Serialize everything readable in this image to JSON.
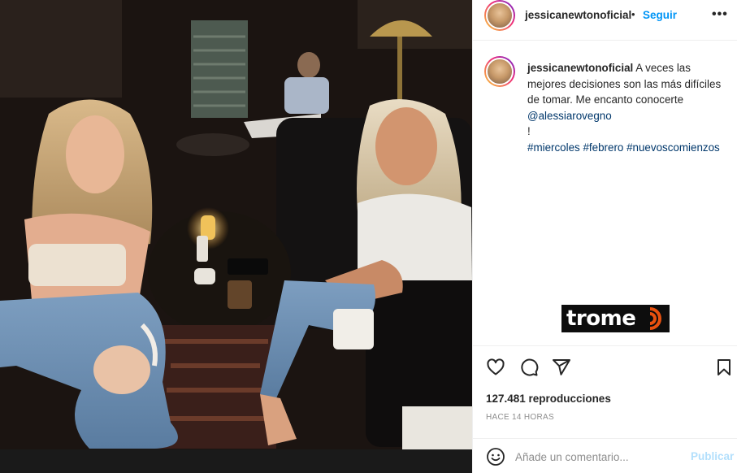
{
  "post": {
    "username": "jessicanewtonoficial",
    "separator": "•",
    "follow_label": "Seguir",
    "more_label": "•••"
  },
  "caption": {
    "username": "jessicanewtonoficial",
    "text": "A veces las mejores decisiones son las más difíciles de tomar. Me encanto conocerte",
    "mention": "@alessiarovegno",
    "end": "!",
    "hashtags": [
      "#miercoles",
      "#febrero",
      "#nuevoscomienzos"
    ]
  },
  "watermark": {
    "text": "trome",
    "color": "#e8510f"
  },
  "actions": {
    "icons": [
      "heart-icon",
      "comment-icon",
      "share-icon",
      "bookmark-icon"
    ]
  },
  "stats": {
    "views": "127.481 reproducciones",
    "time": "HACE 14 HORAS"
  },
  "comment": {
    "placeholder": "Añade un comentario...",
    "publish_label": "Publicar"
  },
  "colors": {
    "link": "#0095f6",
    "hashtag": "#00376b",
    "publish_disabled": "#b2dffc"
  }
}
